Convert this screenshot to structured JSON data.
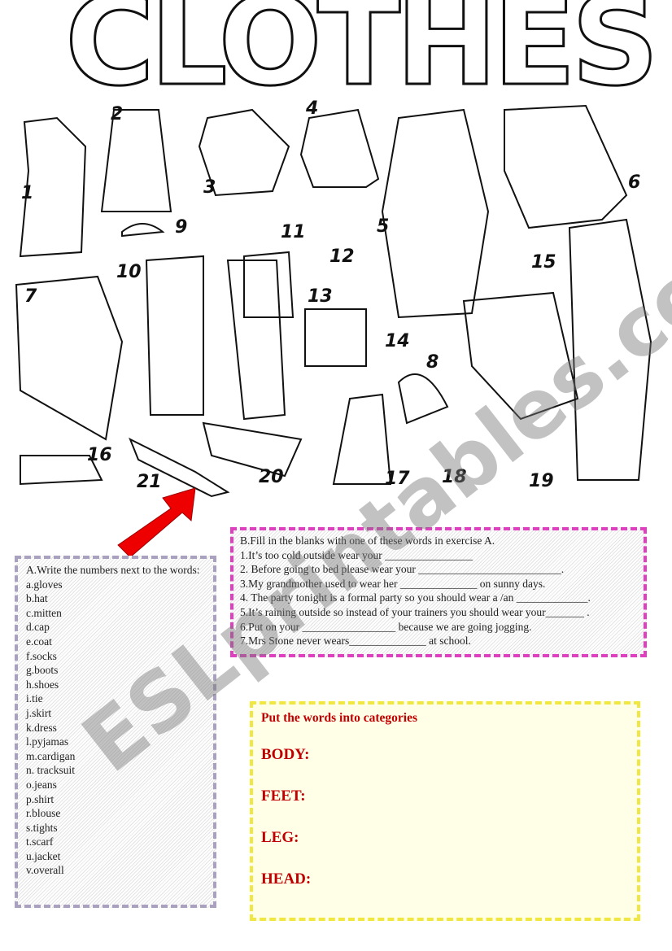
{
  "title": "CLOTHES",
  "picture": {
    "numbers": [
      "1",
      "2",
      "3",
      "4",
      "5",
      "6",
      "7",
      "8",
      "9",
      "10",
      "11",
      "12",
      "13",
      "14",
      "15",
      "16",
      "17",
      "18",
      "19",
      "20",
      "21"
    ]
  },
  "exercise_a": {
    "heading": "A.Write the numbers next to the words:",
    "items": [
      "a.gloves",
      "b.hat",
      "c.mitten",
      "d.cap",
      "e.coat",
      "f.socks",
      "g.boots",
      "h.shoes",
      "i.tie",
      "j.skirt",
      "k.dress",
      "l.pyjamas",
      "m.cardigan",
      "n. tracksuit",
      "o.jeans",
      "p.shirt",
      "r.blouse",
      "s.tights",
      "t.scarf",
      "u.jacket",
      "v.overall"
    ]
  },
  "exercise_b": {
    "heading": "B.Fill in the blanks with one of these words in exercise A.",
    "items": [
      "1.It’s too cold outside wear your ________________",
      "2. Before going to bed please wear your __________________________.",
      "3.My grandmother used to wear her ______________ on sunny days.",
      "4. The party  tonight is a formal party so you should wear a /an _____________.",
      "5.It’s raining outside so instead of your trainers you should wear your_______ .",
      "6.Put on your _________________ because we are going  jogging.",
      "7.Mrs Stone never wears______________  at school."
    ]
  },
  "categories": {
    "heading": "Put the  words into categories",
    "items": [
      "BODY:",
      "FEET:",
      "LEG:",
      "HEAD:"
    ]
  },
  "watermark": "ESLprintables.com",
  "colors": {
    "box_a_border": "#a9a1bd",
    "box_b_border": "#e040c0",
    "box_c_border": "#f0e840",
    "category_text": "#c00000",
    "arrow": "#ee0000"
  }
}
